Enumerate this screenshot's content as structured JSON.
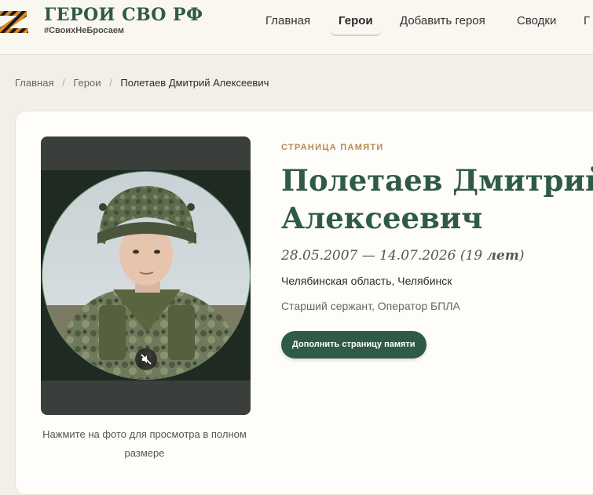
{
  "brand": {
    "title": "ГЕРОИ СВО РФ",
    "tagline": "#СвоихНеБросаем"
  },
  "nav": {
    "items": [
      {
        "label": "Главная",
        "active": false
      },
      {
        "label": "Герои",
        "active": true
      },
      {
        "label": "Добавить героя",
        "active": false
      },
      {
        "label": "Сводки",
        "active": false
      },
      {
        "label": "Г",
        "active": false
      }
    ]
  },
  "breadcrumb": {
    "items": [
      "Главная",
      "Герои"
    ],
    "current": "Полетаев Дмитрий Алексеевич"
  },
  "photo": {
    "caption": "Нажмите на фото для просмотра в полном размере",
    "badge_icon": "muted-speaker-icon"
  },
  "profile": {
    "eyebrow": "СТРАНИЦА ПАМЯТИ",
    "name_line1": "Полетаев Дмитрий",
    "name_line2": "Алексеевич",
    "birth_date": "28.05.2007",
    "death_date": "14.07.2026",
    "age": "19",
    "age_unit": "лет",
    "region": "Челябинская область, Челябинск",
    "rank": "Старший сержант, Оператор БПЛА",
    "cta_label": "Дополнить страницу памяти"
  },
  "colors": {
    "accent": "#2f5a48",
    "eyebrow": "#b8874f",
    "page_bg": "#f3efe6"
  }
}
